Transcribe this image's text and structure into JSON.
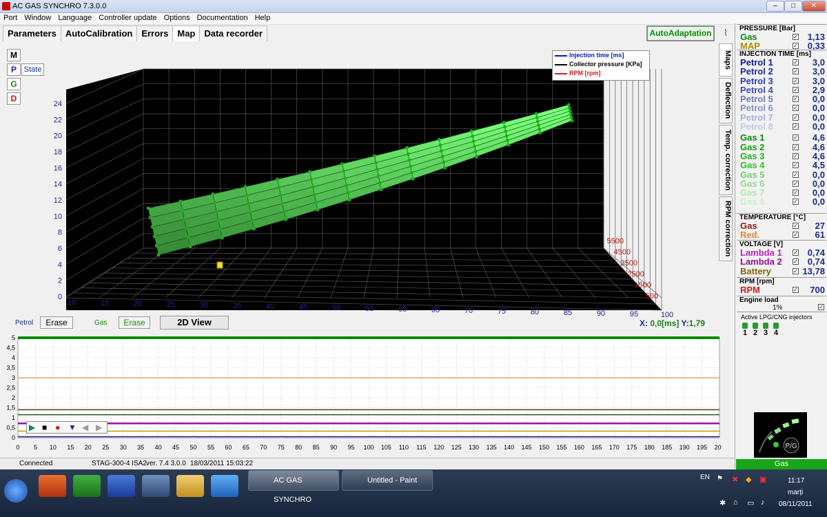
{
  "window": {
    "title": "AC GAS SYNCHRO  7.3.0.0"
  },
  "menu": [
    "Port",
    "Window",
    "Language",
    "Controller update",
    "Options",
    "Documentation",
    "Help"
  ],
  "tabs": [
    "Parameters",
    "AutoCalibration",
    "Errors",
    "Map",
    "Data recorder"
  ],
  "autoadaptation": "AutoAdaptation",
  "vtabs": [
    "Maps",
    "Deflection",
    "Temp. correction",
    "RPM correction"
  ],
  "mode_buttons": [
    "M",
    "P",
    "G",
    "D"
  ],
  "state_button": "State",
  "legend": [
    {
      "label": "Injection time [ms]",
      "color": "#0a1aa8"
    },
    {
      "label": "Collector pressure [KPa]",
      "color": "#000000"
    },
    {
      "label": "RPM [rpm]",
      "color": "#d81818"
    }
  ],
  "plot3d": {
    "z_ticks": [
      "0",
      "2",
      "4",
      "6",
      "8",
      "10",
      "12",
      "14",
      "16",
      "18",
      "20",
      "22",
      "24"
    ],
    "x_ticks": [
      "10",
      "15",
      "20",
      "25",
      "30",
      "35",
      "40",
      "45",
      "50",
      "55",
      "60",
      "65",
      "70",
      "75",
      "80",
      "85",
      "90",
      "95",
      "100"
    ],
    "y_ticks": [
      "5500",
      "4500",
      "3500",
      "2500",
      "1500",
      "500"
    ]
  },
  "bottom_controls": {
    "petrol_label": "Petrol",
    "erase1": "Erase",
    "gas_label": "Gas",
    "erase2": "Erase",
    "view2d": "2D View"
  },
  "coords": {
    "x_label": "X:",
    "x_value": "0,0[ms]",
    "y_label": "Y:",
    "y_value": "1,79"
  },
  "chart_data": {
    "type": "line",
    "title": "",
    "xlabel": "",
    "ylabel": "",
    "xlim": [
      0,
      200
    ],
    "ylim": [
      0,
      5
    ],
    "x_ticks": [
      "0",
      "5",
      "10",
      "15",
      "20",
      "25",
      "30",
      "35",
      "40",
      "45",
      "50",
      "55",
      "60",
      "65",
      "70",
      "75",
      "80",
      "85",
      "90",
      "95",
      "100",
      "105",
      "110",
      "115",
      "120",
      "125",
      "130",
      "135",
      "140",
      "145",
      "150",
      "155",
      "160",
      "165",
      "170",
      "175",
      "180",
      "185",
      "190",
      "195",
      "200"
    ],
    "y_ticks": [
      "0",
      "0,5",
      "1",
      "1,5",
      "2",
      "2,5",
      "3",
      "3,5",
      "4",
      "4,5",
      "5"
    ],
    "series": [
      {
        "values": [
          3.0,
          3.0,
          3.0,
          3.0,
          3.0
        ],
        "x": [
          0,
          50,
          100,
          150,
          200
        ],
        "color": "#e8a070"
      },
      {
        "values": [
          1.4,
          1.4,
          1.4,
          1.4,
          1.4
        ],
        "x": [
          0,
          50,
          100,
          150,
          200
        ],
        "color": "#5a3a10"
      },
      {
        "values": [
          1.15,
          1.15,
          1.15,
          1.15,
          1.15
        ],
        "x": [
          0,
          50,
          100,
          150,
          200
        ],
        "color": "#1a5a1a"
      },
      {
        "values": [
          0.74,
          0.74,
          0.74,
          0.74,
          0.74
        ],
        "x": [
          0,
          50,
          100,
          150,
          200
        ],
        "color": "#c020c0"
      },
      {
        "values": [
          0.7,
          0.7,
          0.7,
          0.7,
          0.7
        ],
        "x": [
          0,
          50,
          100,
          150,
          200
        ],
        "color": "#901090"
      },
      {
        "values": [
          0.33,
          0.33,
          0.33,
          0.33,
          0.33
        ],
        "x": [
          0,
          50,
          100,
          150,
          200
        ],
        "color": "#b0a000"
      },
      {
        "values": [
          0.05,
          0.05,
          0.05,
          0.05,
          0.05
        ],
        "x": [
          0,
          50,
          100,
          150,
          200
        ],
        "color": "#1a2a8a"
      },
      {
        "values": [
          5.0,
          5.0,
          5.0,
          5.0,
          5.0
        ],
        "x": [
          0,
          50,
          100,
          150,
          200
        ],
        "color": "#0a8a0a"
      }
    ]
  },
  "status": {
    "connected": "Connected",
    "device": "STAG-300-4 ISA2",
    "version": "ver. 7.4  3.0.0",
    "date": "18/03/2011 15:03:22"
  },
  "right": {
    "pressure_header": "PRESSURE [Bar]",
    "pressure": [
      {
        "name": "Gas",
        "value": "1,13",
        "color": "#0a8a0a"
      },
      {
        "name": "MAP",
        "value": "0,33",
        "color": "#a89000"
      }
    ],
    "injection_header": "INJECTION TIME [ms]",
    "petrol": [
      {
        "name": "Petrol 1",
        "value": "3,0",
        "color": "#0a1a9a"
      },
      {
        "name": "Petrol 2",
        "value": "3,0",
        "color": "#1a2aa6"
      },
      {
        "name": "Petrol 3",
        "value": "3,0",
        "color": "#2a3ab0"
      },
      {
        "name": "Petrol 4",
        "value": "2,9",
        "color": "#3a4ab8"
      },
      {
        "name": "Petrol 5",
        "value": "0,0",
        "color": "#7078c0"
      },
      {
        "name": "Petrol 6",
        "value": "0,0",
        "color": "#8890cc"
      },
      {
        "name": "Petrol 7",
        "value": "0,0",
        "color": "#a8b0dc"
      },
      {
        "name": "Petrol 8",
        "value": "0,0",
        "color": "#c4c8e8"
      }
    ],
    "gas": [
      {
        "name": "Gas 1",
        "value": "4,6",
        "color": "#0a8a0a"
      },
      {
        "name": "Gas 2",
        "value": "4,6",
        "color": "#10a010"
      },
      {
        "name": "Gas 3",
        "value": "4,6",
        "color": "#20b020"
      },
      {
        "name": "Gas 4",
        "value": "4,5",
        "color": "#30c030"
      },
      {
        "name": "Gas 5",
        "value": "0,0",
        "color": "#70d070"
      },
      {
        "name": "Gas 6",
        "value": "0,0",
        "color": "#90dc90"
      },
      {
        "name": "Gas 7",
        "value": "0,0",
        "color": "#b0e8b0"
      },
      {
        "name": "Gas 8",
        "value": "0,0",
        "color": "#c8f0c8"
      }
    ],
    "temperature_header": "TEMPERATURE [°C]",
    "temperature": [
      {
        "name": "Gas",
        "value": "27",
        "color": "#8a1a0a"
      },
      {
        "name": "Red.",
        "value": "61",
        "color": "#e88030"
      }
    ],
    "voltage_header": "VOLTAGE [V]",
    "voltage": [
      {
        "name": "Lambda 1",
        "value": "0,74",
        "color": "#c020c0"
      },
      {
        "name": "Lambda 2",
        "value": "0,74",
        "color": "#901090"
      },
      {
        "name": "Battery",
        "value": "13,78",
        "color": "#806000"
      }
    ],
    "rpm_header": "RPM [rpm]",
    "rpm": {
      "name": "RPM",
      "value": "700",
      "color": "#d81818"
    },
    "engine_load_label": "Engine load",
    "engine_load_value": "1%",
    "injectors_label": "Active LPG/CNG injectors",
    "injectors": [
      "1",
      "2",
      "3",
      "4"
    ],
    "pg_label": "P/G",
    "status_label": "Gas"
  },
  "taskbar": {
    "buttons": [
      "AC GAS SYNCHRO",
      "Untitled - Paint"
    ],
    "lang": "EN",
    "time": "11:17",
    "day": "marți",
    "date": "08/11/2011"
  }
}
